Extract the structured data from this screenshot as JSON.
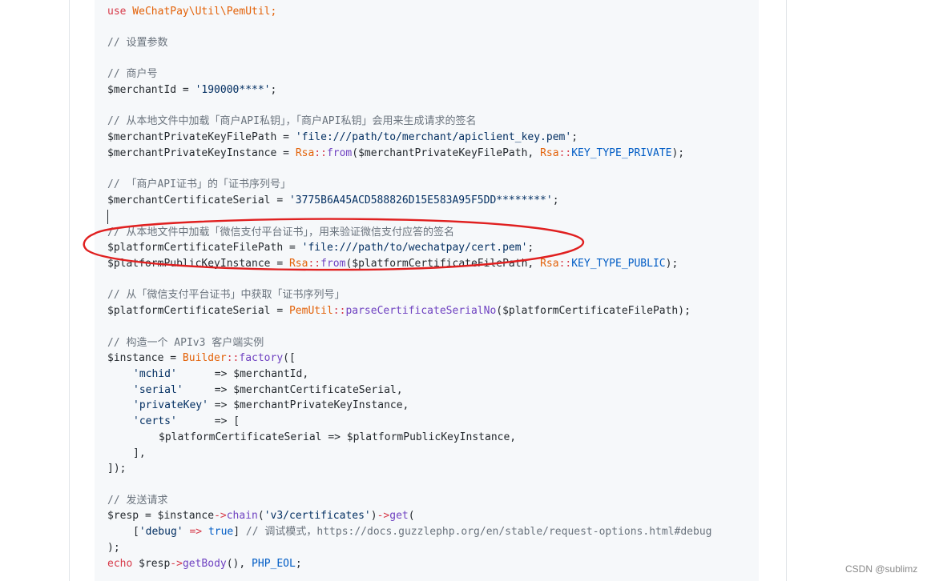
{
  "code": {
    "l0": {
      "t1": "use",
      "t2": " WeChatPay\\Util\\PemUtil;"
    },
    "l2": "// 设置参数",
    "l4": "// 商户号",
    "l5": {
      "a": "$merchantId = ",
      "b": "'190000****'",
      "c": ";"
    },
    "l7": "// 从本地文件中加载「商户API私钥」，「商户API私钥」会用来生成请求的签名",
    "l8": {
      "a": "$merchantPrivateKeyFilePath = ",
      "b": "'file:///path/to/merchant/apiclient_key.pem'",
      "c": ";"
    },
    "l9": {
      "a": "$merchantPrivateKeyInstance = ",
      "cls": "Rsa",
      "op": "::",
      "f": "from",
      "d": "($merchantPrivateKeyFilePath, ",
      "cls2": "Rsa",
      "op2": "::",
      "kw": "KEY_TYPE_PRIVATE",
      "e": ");"
    },
    "l11": "// 「商户API证书」的「证书序列号」",
    "l12": {
      "a": "$merchantCertificateSerial = ",
      "b": "'3775B6A45ACD588826D15E583A95F5DD********'",
      "c": ";"
    },
    "l14": "// 从本地文件中加载「微信支付平台证书」，用来验证微信支付应答的签名",
    "l15": {
      "a": "$platformCertificateFilePath = ",
      "b": "'file:///path/to/wechatpay/cert.pem'",
      "c": ";"
    },
    "l16": {
      "a": "$platformPublicKeyInstance = ",
      "cls": "Rsa",
      "op": "::",
      "f": "from",
      "d": "($platformCertificateFilePath, ",
      "cls2": "Rsa",
      "op2": "::",
      "kw": "KEY_TYPE_PUBLIC",
      "e": ");"
    },
    "l18": "// 从「微信支付平台证书」中获取「证书序列号」",
    "l19": {
      "a": "$platformCertificateSerial = ",
      "cls": "PemUtil",
      "op": "::",
      "f": "parseCertificateSerialNo",
      "d": "($platformCertificateFilePath);"
    },
    "l21": "// 构造一个 APIv3 客户端实例",
    "l22": {
      "a": "$instance = ",
      "cls": "Builder",
      "op": "::",
      "f": "factory",
      "d": "(["
    },
    "l23": {
      "s": "'mchid'",
      "a": "      => $merchantId,"
    },
    "l24": {
      "s": "'serial'",
      "a": "     => $merchantCertificateSerial,"
    },
    "l25": {
      "s": "'privateKey'",
      "a": " => $merchantPrivateKeyInstance,"
    },
    "l26": {
      "s": "'certs'",
      "a": "      => ["
    },
    "l27": "$platformCertificateSerial => $platformPublicKeyInstance,",
    "l28": "],",
    "l29": "]);",
    "l31": "// 发送请求",
    "l32": {
      "a": "$resp = ",
      "b": "$instance",
      "op": "->",
      "f": "chain",
      "c": "(",
      "s": "'v3/certificates'",
      "d": ")",
      "op2": "->",
      "f2": "get",
      "e": "("
    },
    "l33": {
      "a": "[",
      "s": "'debug'",
      "b": " => ",
      "kw": "true",
      "c": "] ",
      "cm": "// 调试模式，https://docs.guzzlephp.org/en/stable/request-options.html#debug"
    },
    "l34": ");",
    "l35": {
      "k": "echo",
      "a": " $resp",
      "op": "->",
      "f": "getBody",
      "b": "(), ",
      "kw": "PHP_EOL",
      "c": ";"
    }
  },
  "colors": {
    "annotation": "#e02020",
    "code_background": "#f6f8fa"
  },
  "watermark": "CSDN @sublimz"
}
